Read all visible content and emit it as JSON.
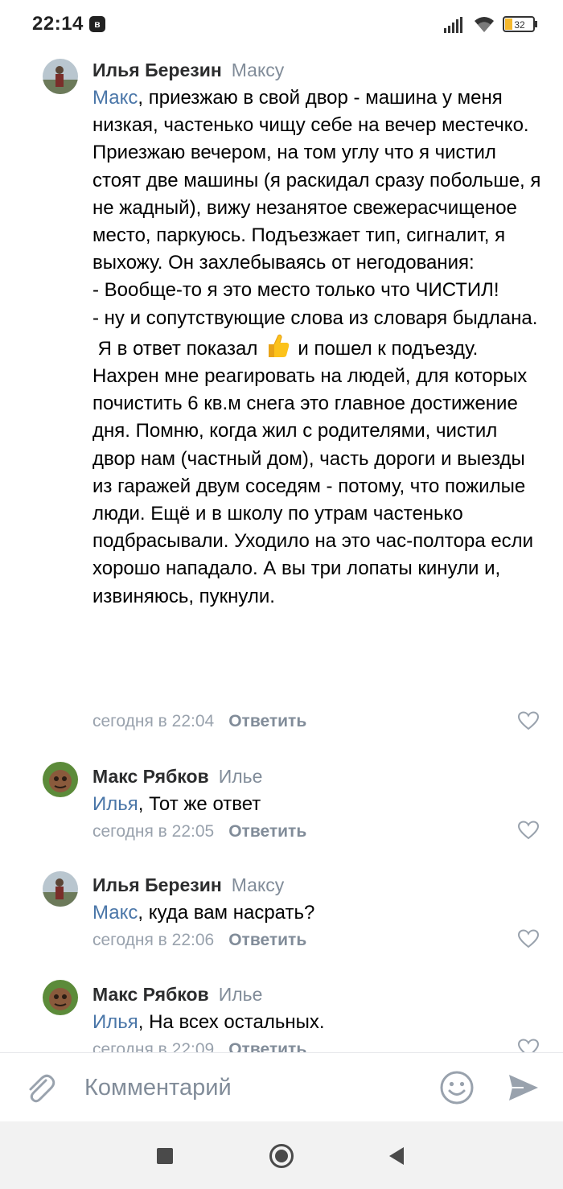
{
  "status_bar": {
    "time": "22:14",
    "app_icon": "vk-icon",
    "battery": "32"
  },
  "comments": [
    {
      "author": "Илья Березин",
      "reply_to": "Максу",
      "mention": "Макс",
      "paragraphs": [
        ", приезжаю в свой двор - машина у меня низкая, частенько чищу себе на вечер местечко. Приезжаю вечером, на том углу что я чистил стоят две машины (я раскидал сразу побольше, я не жадный), вижу незанятое свежерасчищеное место, паркуюсь. Подъезжает тип, сигналит, я выхожу. Он захлебываясь от негодования:",
        "- Вообще-то я это место только что ЧИСТИЛ!",
        "- ну и сопутствующие слова из словаря быдлана."
      ],
      "emoji_line_before": " Я в ответ показал",
      "emoji": "thumbs-up-emoji",
      "emoji_line_after": "и пошел к подъезду.",
      "last_paragraph": " Нахрен мне реагировать на людей, для которых почистить 6 кв.м снега это главное достижение дня. Помню, когда жил с родителями, чистил двор нам (частный дом), часть дороги и выезды из гаражей двум соседям - потому, что пожилые люди. Ещё и в школу по утрам частенько подбрасывали. Уходило на это час-полтора если хорошо нападало. А вы три лопаты кинули и, извиняюсь, пукнули.",
      "date": "сегодня в 22:04",
      "reply_label": "Ответить"
    },
    {
      "author": "Макс Рябков",
      "reply_to": "Илье",
      "mention": "Илья",
      "text": ", Тот же ответ",
      "date": "сегодня в 22:05",
      "reply_label": "Ответить"
    },
    {
      "author": "Илья Березин",
      "reply_to": "Максу",
      "mention": "Макс",
      "text": ", куда вам насрать?",
      "date": "сегодня в 22:06",
      "reply_label": "Ответить"
    },
    {
      "author": "Макс Рябков",
      "reply_to": "Илье",
      "mention": "Илья",
      "text": ", На всех остальных.",
      "date": "сегодня в 22:09",
      "reply_label": "Ответить"
    }
  ],
  "composer": {
    "placeholder": "Комментарий"
  },
  "colors": {
    "link": "#4a76a8",
    "secondary": "#818c99",
    "date": "#99a2ad",
    "accent_icon": "#99a2ad"
  }
}
